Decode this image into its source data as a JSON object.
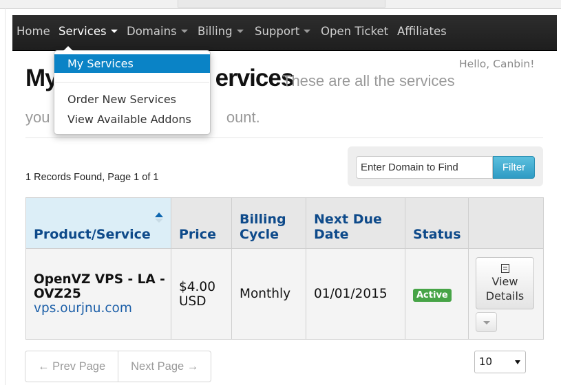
{
  "nav": {
    "home": "Home",
    "services": "Services",
    "domains": "Domains",
    "billing": "Billing",
    "support": "Support",
    "open_ticket": "Open Ticket",
    "affiliates": "Affiliates"
  },
  "services_menu": {
    "items": [
      "My Services",
      "Order New Services",
      "View Available Addons"
    ],
    "active": "My Services"
  },
  "greeting": "Hello, Canbin!",
  "page": {
    "title": "My Services",
    "title_visible": "My",
    "title_visible_right": "ervices",
    "subtitle_line1": "These are all the services",
    "subtitle_line2_left": "you h",
    "subtitle_line2_right": "ount."
  },
  "records_text": "1 Records Found, Page 1 of 1",
  "filter": {
    "placeholder": "Enter Domain to Find",
    "button": "Filter"
  },
  "table": {
    "headers": [
      "Product/Service",
      "Price",
      "Billing Cycle",
      "Next Due Date",
      "Status",
      ""
    ],
    "rows": [
      {
        "product": "OpenVZ VPS - LA - OVZ25",
        "domain": "vps.ourjnu.com",
        "price": "$4.00 USD",
        "billing_cycle": "Monthly",
        "next_due_date": "01/01/2015",
        "status": "Active",
        "action_label": "View Details"
      }
    ]
  },
  "pagination": {
    "prev": "← Prev Page",
    "next": "Next Page →"
  },
  "per_page": "10",
  "colors": {
    "nav_bg": "#222222",
    "dropdown_active": "#0a83c6",
    "header_text": "#0e4a8a",
    "status_active": "#47a447",
    "filter_button": "#2f9bc4"
  }
}
